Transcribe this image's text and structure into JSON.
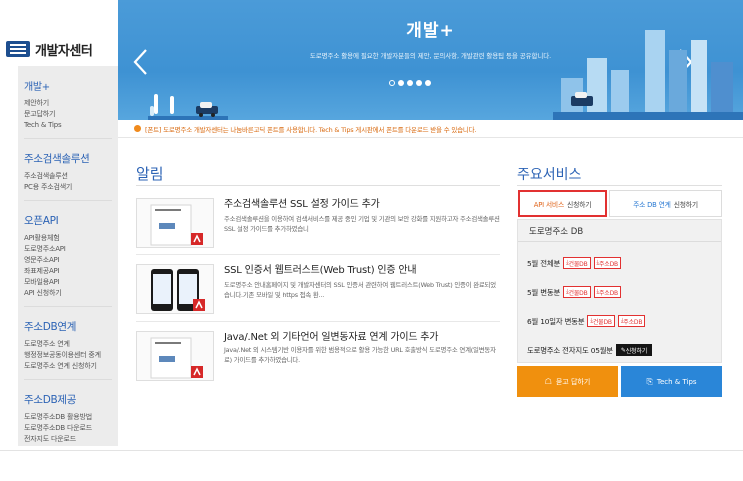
{
  "sidebar": {
    "logo_text": "개발자센터",
    "groups": [
      {
        "head": "개발+",
        "items": [
          "제안하기",
          "문고답하기",
          "Tech & Tips"
        ]
      },
      {
        "head": "주소검색솔루션",
        "items": [
          "주소검색솔루션",
          "PC용 주소검색기"
        ]
      },
      {
        "head": "오픈API",
        "items": [
          "API활용체험",
          "도로명주소API",
          "영문주소API",
          "좌표제공API",
          "모바일용API",
          "API 신청하기"
        ]
      },
      {
        "head": "주소DB연계",
        "items": [
          "도로명주소 연계",
          "행정정보공동이용센터 중계",
          "도로명주소 연계 신청하기"
        ]
      },
      {
        "head": "주소DB제공",
        "items": [
          "도로명주소DB 활용방법",
          "도로명주소DB 다운로드",
          "전자지도 다운로드"
        ]
      }
    ]
  },
  "banner": {
    "title": "개발+",
    "subtitle": "도로명주소 활용에 필요한 개발자분들의 제안, 문의사항, 개발관련 활용팁 등을 공유합니다."
  },
  "notice": {
    "text": "[폰트] 도로명주소 개발자센터는 나눔바른고딕 폰트를 사용합니다. Tech & Tips 게시판에서 폰트를 다운로드 받을 수 있습니다."
  },
  "news": {
    "title": "알림",
    "items": [
      {
        "title": "주소검색솔루션 SSL 설정 가이드 추가",
        "desc": "주소검색솔루션을 이용하여 검색서비스를 제공 중인 기업 및 기관의 보안 강화를 지원하고자 주소검색솔루션 SSL 설정 가이드를 추가하였습니"
      },
      {
        "title": "SSL 인증서 웹트러스트(Web Trust) 인증 안내",
        "desc": "도로명주소 안내홈페이지 및 개발자센터의 SSL 인증서 관련하여 웹트러스트(Web Trust) 인증이 완료되었습니다.기존 모바일 및 https 접속 환..."
      },
      {
        "title": "Java/.Net 외 기타언어 일변동자료 연계 가이드 추가",
        "desc": "Java/.Net 외 시스템기반 이용자를 위한 범용적으로 활용 가능한 URL 호출방식 도로명주소 연계(일변동자료) 가이드를 추가하였습니다."
      }
    ]
  },
  "services": {
    "title": "주요서비스",
    "tab_api": {
      "main": "API 서비스",
      "sub": "신청하기"
    },
    "tab_db": {
      "main": "주소 DB 연계",
      "sub": "신청하기"
    },
    "db_head": "도로명주소 DB",
    "rows": [
      {
        "label": "5월 전체분",
        "buttons": [
          "건물DB",
          "주소DB"
        ]
      },
      {
        "label": "5월 변동분",
        "buttons": [
          "건물DB",
          "주소DB"
        ]
      },
      {
        "label": "6월 10일자 변동분",
        "buttons": [
          "건물DB",
          "주소DB"
        ]
      },
      {
        "label": "도로명주소 전자지도 05월분",
        "buttons": [
          "신청하기"
        ]
      }
    ],
    "btn_qna": "묻고 답하기",
    "btn_tech": "Tech & Tips"
  },
  "colors": {
    "accent_blue": "#2c63b5",
    "banner_blue": "#3e92d3",
    "orange": "#f0900e",
    "red": "#e23131"
  }
}
